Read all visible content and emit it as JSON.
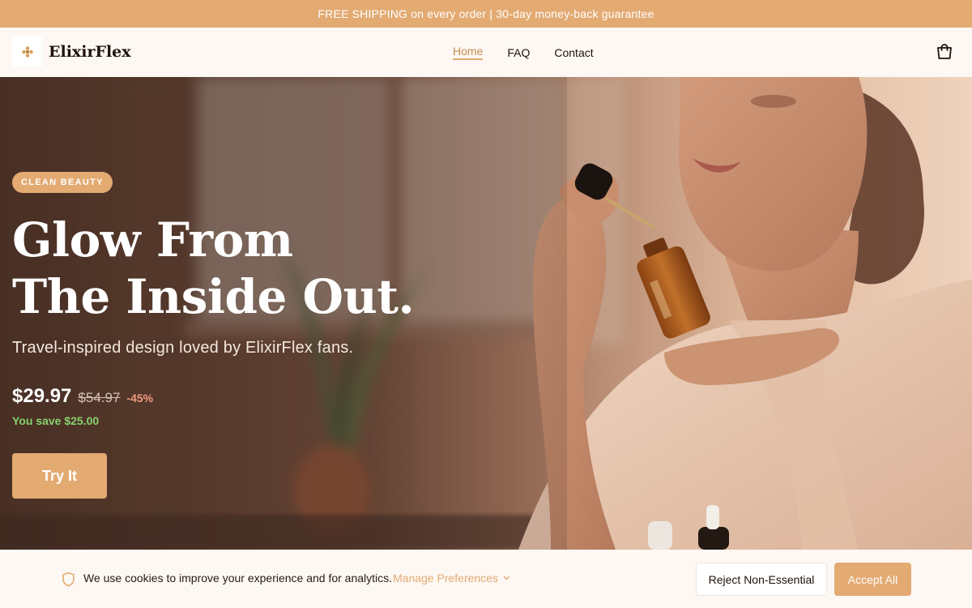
{
  "announcement": "FREE SHIPPING on every order | 30-day money-back guarantee",
  "brand": {
    "name": "ElixirFlex",
    "accent": "#e3aa72"
  },
  "nav": {
    "links": [
      {
        "label": "Home",
        "active": true
      },
      {
        "label": "FAQ",
        "active": false
      },
      {
        "label": "Contact",
        "active": false
      }
    ],
    "cart_icon": "shopping-bag-icon"
  },
  "hero": {
    "badge": "CLEAN BEAUTY",
    "headline_line1": "Glow From",
    "headline_line2": "The Inside Out.",
    "subheadline": "Travel-inspired design loved by ElixirFlex fans.",
    "price": "$29.97",
    "original_price": "$54.97",
    "discount": "-45%",
    "savings": "You save $25.00",
    "cta": "Try It"
  },
  "cookie_banner": {
    "message": "We use cookies to improve your experience and for analytics.",
    "manage_label": "Manage Preferences",
    "reject_label": "Reject Non-Essential",
    "accept_label": "Accept All",
    "icon": "shield-icon"
  }
}
